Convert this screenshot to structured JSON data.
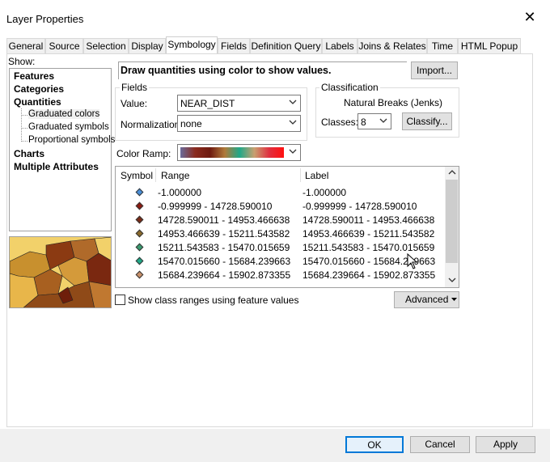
{
  "window": {
    "title": "Layer Properties"
  },
  "tabs": [
    {
      "label": "General"
    },
    {
      "label": "Source"
    },
    {
      "label": "Selection"
    },
    {
      "label": "Display"
    },
    {
      "label": "Symbology"
    },
    {
      "label": "Fields"
    },
    {
      "label": "Definition Query"
    },
    {
      "label": "Labels"
    },
    {
      "label": "Joins & Relates"
    },
    {
      "label": "Time"
    },
    {
      "label": "HTML Popup"
    }
  ],
  "active_tab": "Symbology",
  "show": {
    "label": "Show:",
    "items": [
      "Features",
      "Categories",
      "Quantities"
    ],
    "sub_items": [
      "Graduated colors",
      "Graduated symbols",
      "Proportional symbols"
    ],
    "items_after": [
      "Charts",
      "Multiple Attributes"
    ]
  },
  "description": "Draw quantities using color to show values.",
  "import_label": "Import...",
  "fields": {
    "legend": "Fields",
    "value_label": "Value:",
    "value": "NEAR_DIST",
    "normalization_label": "Normalization:",
    "normalization": "none"
  },
  "classification": {
    "legend": "Classification",
    "method": "Natural Breaks (Jenks)",
    "classes_label": "Classes:",
    "classes": "8",
    "classify_label": "Classify..."
  },
  "color_ramp": {
    "label": "Color Ramp:",
    "stops": [
      "#6b6b9b",
      "#8a2a1e",
      "#6e1a10",
      "#b07a3a",
      "#20a888",
      "#c8a070",
      "#e03040",
      "#ff1010"
    ]
  },
  "table": {
    "headers": {
      "symbol": "Symbol",
      "range": "Range",
      "label": "Label"
    },
    "rows": [
      {
        "range": "-1.000000",
        "label": "-1.000000",
        "color": "#4a8fd8"
      },
      {
        "range": "-0.999999 - 14728.590010",
        "label": "-0.999999 - 14728.590010",
        "color": "#8b1a10"
      },
      {
        "range": "14728.590011 - 14953.466638",
        "label": "14728.590011 - 14953.466638",
        "color": "#7a2c18"
      },
      {
        "range": "14953.466639 - 15211.543582",
        "label": "14953.466639 - 15211.543582",
        "color": "#8a6a2c"
      },
      {
        "range": "15211.543583 - 15470.015659",
        "label": "15211.543583 - 15470.015659",
        "color": "#3a9a70"
      },
      {
        "range": "15470.015660 - 15684.239663",
        "label": "15470.015660 - 15684.239663",
        "color": "#20a888"
      },
      {
        "range": "15684.239664 - 15902.873355",
        "label": "15684.239664 - 15902.873355",
        "color": "#c8906a"
      }
    ]
  },
  "show_class_ranges_label": "Show class ranges using feature values",
  "advanced_label": "Advanced",
  "buttons": {
    "ok": "OK",
    "cancel": "Cancel",
    "apply": "Apply"
  }
}
